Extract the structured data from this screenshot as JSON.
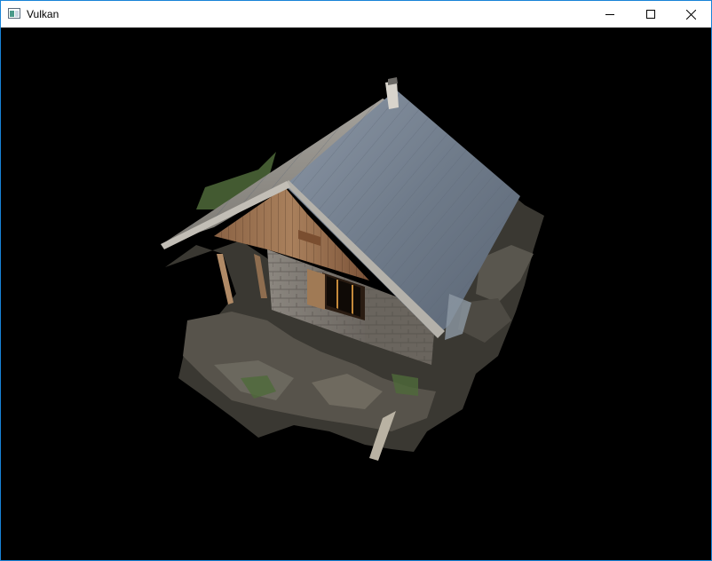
{
  "window": {
    "title": "Vulkan",
    "app_icon": "application-window-icon",
    "controls": {
      "minimize_icon": "minimize-icon",
      "maximize_icon": "maximize-icon",
      "close_icon": "close-icon"
    },
    "accent_border_color": "#1883d7"
  },
  "viewport": {
    "background_color": "#000000",
    "content": "3d-render-stone-cabin-with-slate-roof"
  }
}
